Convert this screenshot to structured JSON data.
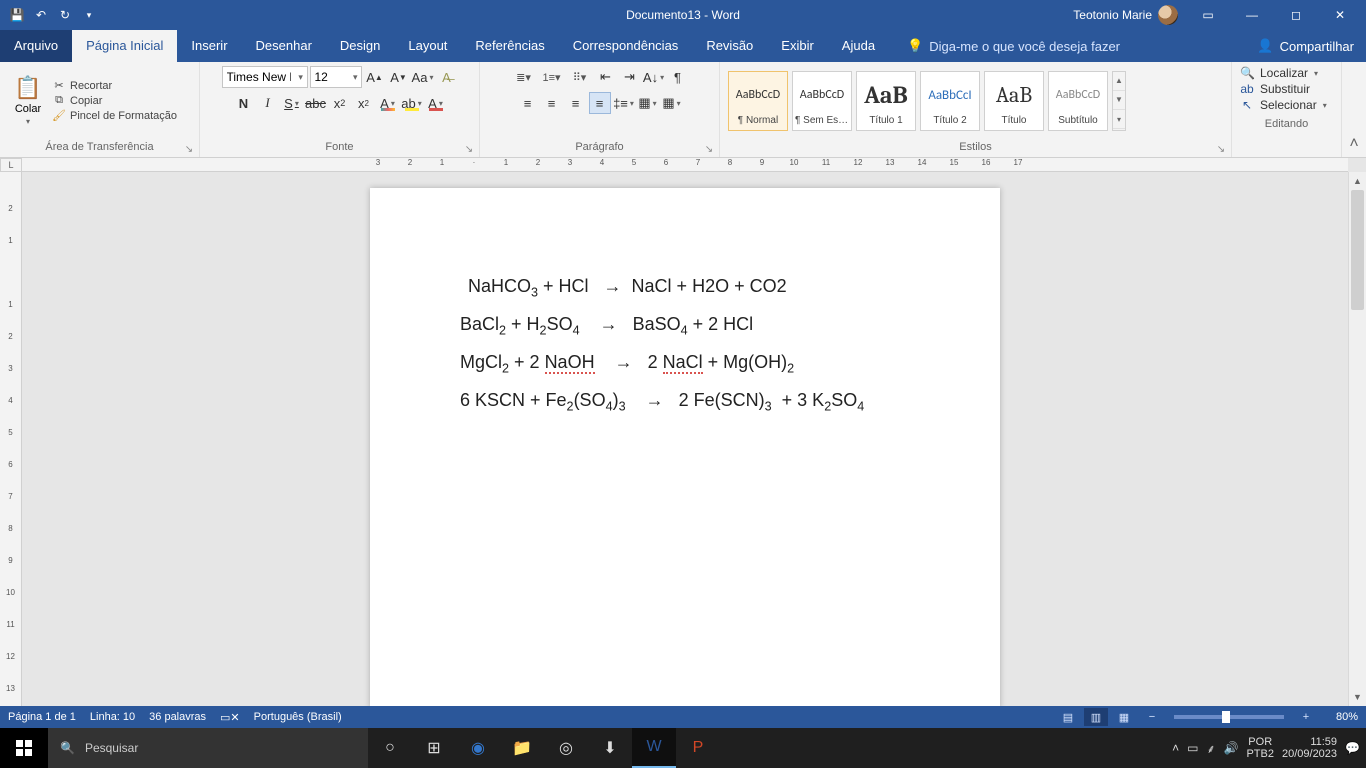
{
  "titlebar": {
    "doc_title": "Documento13 - Word",
    "user_name": "Teotonio Marie"
  },
  "tabs": {
    "file": "Arquivo",
    "home": "Página Inicial",
    "insert": "Inserir",
    "draw": "Desenhar",
    "design": "Design",
    "layout": "Layout",
    "references": "Referências",
    "mailings": "Correspondências",
    "review": "Revisão",
    "view": "Exibir",
    "help": "Ajuda",
    "tellme_placeholder": "Diga-me o que você deseja fazer",
    "share": "Compartilhar"
  },
  "ribbon": {
    "clipboard": {
      "label": "Área de Transferência",
      "paste": "Colar",
      "cut": "Recortar",
      "copy": "Copiar",
      "format_painter": "Pincel de Formatação"
    },
    "font": {
      "label": "Fonte",
      "name": "Times New R",
      "size": "12"
    },
    "paragraph": {
      "label": "Parágrafo"
    },
    "styles": {
      "label": "Estilos",
      "items": [
        {
          "preview": "AaBbCcD",
          "name": "¶ Normal"
        },
        {
          "preview": "AaBbCcD",
          "name": "¶ Sem Esp..."
        },
        {
          "preview": "AaB",
          "name": "Título 1"
        },
        {
          "preview": "AaBbCcI",
          "name": "Título 2"
        },
        {
          "preview": "AaB",
          "name": "Título"
        },
        {
          "preview": "AaBbCcD",
          "name": "Subtítulo"
        }
      ]
    },
    "editing": {
      "label": "Editando",
      "find": "Localizar",
      "replace": "Substituir",
      "select": "Selecionar"
    }
  },
  "document": {
    "lines": [
      "NaHCO₃ + HCl   →  NaCl + H2O + CO2",
      "BaCl₂ + H₂SO₄    →   BaSO₄ + 2 HCl",
      "MgCl₂ + 2 NaOH    →   2 NaCl + Mg(OH)₂",
      "6 KSCN + Fe₂(SO₄)₃    →   2 Fe(SCN)₃  + 3 K₂SO₄"
    ]
  },
  "statusbar": {
    "page": "Página 1 de 1",
    "line": "Linha: 10",
    "words": "36 palavras",
    "language": "Português (Brasil)",
    "zoom": "80%"
  },
  "taskbar": {
    "search_placeholder": "Pesquisar",
    "lang1": "POR",
    "lang2": "PTB2",
    "time": "11:59",
    "date": "20/09/2023"
  }
}
